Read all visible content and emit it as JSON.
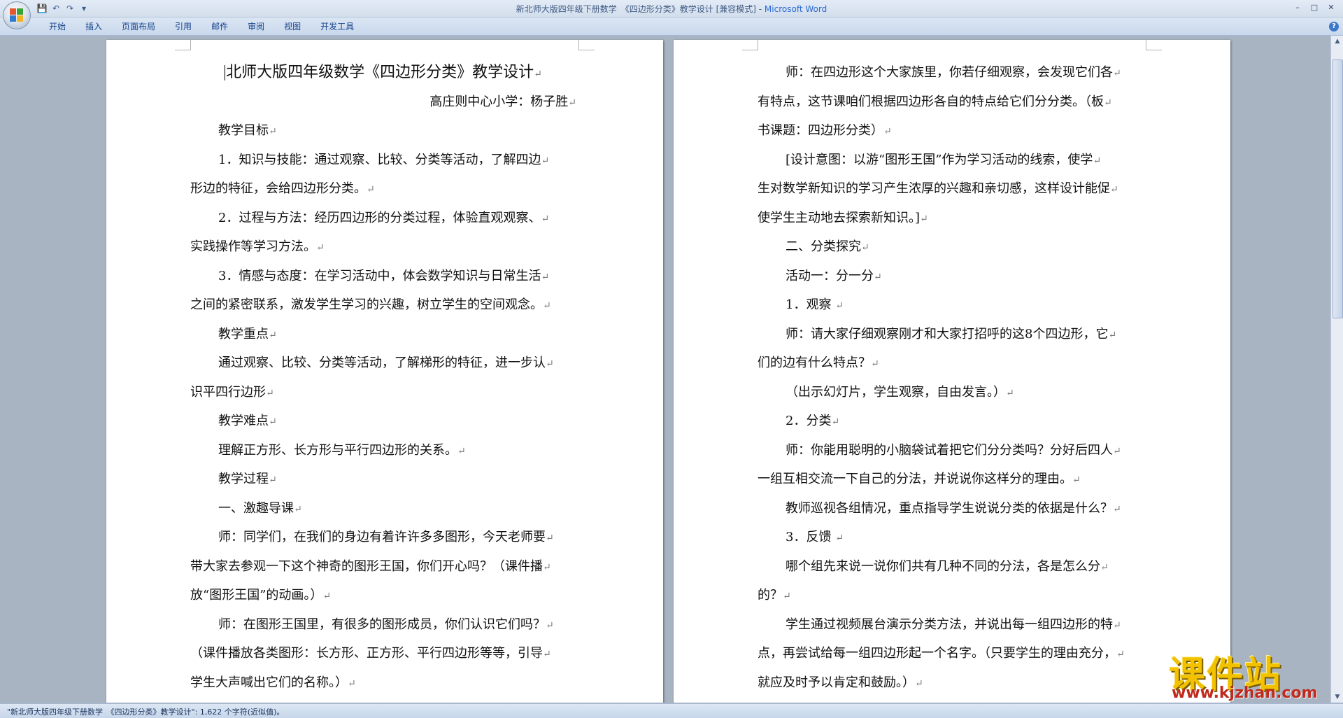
{
  "window": {
    "title": "新北师大版四年级下册数学　《四边形分类》教学设计 [兼容模式] - ",
    "app_name": "Microsoft Word",
    "controls": [
      "–",
      "□",
      "✕"
    ]
  },
  "quick_access": {
    "icons": [
      "save-icon",
      "undo-icon",
      "redo-icon",
      "customize-icon"
    ],
    "glyphs": [
      "💾",
      "↶",
      "↷",
      "▾"
    ]
  },
  "ribbon": {
    "tabs": [
      "开始",
      "插入",
      "页面布局",
      "引用",
      "邮件",
      "审阅",
      "视图",
      "开发工具"
    ],
    "help": "?"
  },
  "page1": {
    "lines": [
      {
        "text": "北师大版四年级数学《四边形分类》教学设计",
        "style": "title"
      },
      {
        "text": "高庄则中心小学：杨子胜",
        "style": "right"
      },
      {
        "text": "教学目标",
        "style": "ind"
      },
      {
        "text": "1．知识与技能：通过观察、比较、分类等活动，了解四边",
        "style": "ind"
      },
      {
        "text": "形边的特征，会给四边形分类。",
        "style": ""
      },
      {
        "text": "2．过程与方法：经历四边形的分类过程，体验直观观察、",
        "style": "ind"
      },
      {
        "text": "实践操作等学习方法。",
        "style": ""
      },
      {
        "text": "3．情感与态度：在学习活动中，体会数学知识与日常生活",
        "style": "ind"
      },
      {
        "text": "之间的紧密联系，激发学生学习的兴趣，树立学生的空间观念。",
        "style": ""
      },
      {
        "text": "教学重点",
        "style": "ind"
      },
      {
        "text": "通过观察、比较、分类等活动，了解梯形的特征，进一步认",
        "style": "ind"
      },
      {
        "text": "识平四行边形",
        "style": ""
      },
      {
        "text": "教学难点",
        "style": "ind"
      },
      {
        "text": "理解正方形、长方形与平行四边形的关系。",
        "style": "ind"
      },
      {
        "text": "教学过程",
        "style": "ind"
      },
      {
        "text": "一、激趣导课",
        "style": "ind"
      },
      {
        "text": "师：同学们，在我们的身边有着许许多多图形，今天老师要",
        "style": "ind"
      },
      {
        "text": "带大家去参观一下这个神奇的图形王国，你们开心吗？（课件播",
        "style": ""
      },
      {
        "text": "放“图形王国”的动画。）",
        "style": ""
      },
      {
        "text": "师：在图形王国里，有很多的图形成员，你们认识它们吗？",
        "style": "ind"
      },
      {
        "text": "（课件播放各类图形：长方形、正方形、平行四边形等等，引导",
        "style": ""
      },
      {
        "text": "学生大声喊出它们的名称。）",
        "style": ""
      }
    ]
  },
  "page2": {
    "lines": [
      {
        "text": "师：在四边形这个大家族里，你若仔细观察，会发现它们各",
        "style": "ind"
      },
      {
        "text": "有特点，这节课咱们根据四边形各自的特点给它们分分类。（板",
        "style": ""
      },
      {
        "text": "书课题：四边形分类）",
        "style": ""
      },
      {
        "text": "[设计意图：以游“图形王国”作为学习活动的线索，使学",
        "style": "ind"
      },
      {
        "text": "生对数学新知识的学习产生浓厚的兴趣和亲切感，这样设计能促",
        "style": ""
      },
      {
        "text": "使学生主动地去探索新知识。]",
        "style": ""
      },
      {
        "text": "二、分类探究",
        "style": "ind"
      },
      {
        "text": "活动一：分一分",
        "style": "ind"
      },
      {
        "text": "1．观察 ",
        "style": "ind"
      },
      {
        "text": "师：请大家仔细观察刚才和大家打招呼的这8个四边形，它",
        "style": "ind"
      },
      {
        "text": "们的边有什么特点？",
        "style": ""
      },
      {
        "text": "（出示幻灯片，学生观察，自由发言。）",
        "style": "ind"
      },
      {
        "text": "2．分类",
        "style": "ind"
      },
      {
        "text": "师：你能用聪明的小脑袋试着把它们分分类吗？分好后四人",
        "style": "ind"
      },
      {
        "text": "一组互相交流一下自己的分法，并说说你这样分的理由。",
        "style": ""
      },
      {
        "text": "教师巡视各组情况，重点指导学生说说分类的依据是什么？",
        "style": "ind"
      },
      {
        "text": "3．反馈 ",
        "style": "ind"
      },
      {
        "text": "哪个组先来说一说你们共有几种不同的分法，各是怎么分",
        "style": "ind"
      },
      {
        "text": "的？",
        "style": ""
      },
      {
        "text": "学生通过视频展台演示分类方法，并说出每一组四边形的特",
        "style": "ind"
      },
      {
        "text": "点，再尝试给每一组四边形起一个名字。（只要学生的理由充分，",
        "style": ""
      },
      {
        "text": "就应及时予以肯定和鼓励。）",
        "style": ""
      }
    ]
  },
  "paragraph_mark": "↵",
  "status": {
    "text": "\"新北师大版四年级下册数学　《四边形分类》教学设计\": 1,622 个字符(近似值)。"
  },
  "watermark": {
    "main": "课件站",
    "url": "www.kjzhan.com"
  },
  "scrollbar": {
    "up": "▲",
    "down": "▼"
  }
}
